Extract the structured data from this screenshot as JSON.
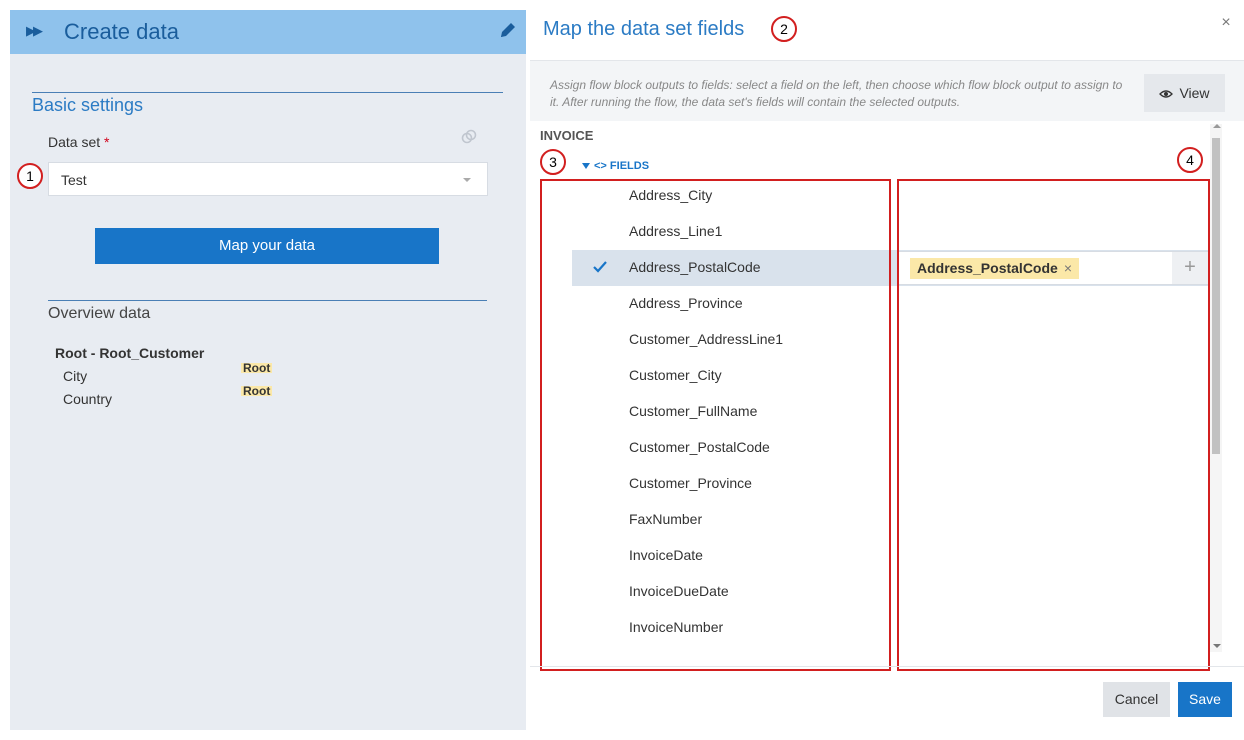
{
  "left_panel": {
    "title": "Create data",
    "basic_settings_title": "Basic settings",
    "dataset_label": "Data set",
    "required_mark": "*",
    "dataset_value": "Test",
    "map_button_label": "Map your data",
    "overview_title": "Overview data",
    "root_title": "Root - Root_Customer",
    "overview_rows": [
      {
        "label": "City",
        "value": "Root"
      },
      {
        "label": "Country",
        "value": "Root"
      }
    ]
  },
  "dialog": {
    "title": "Map the data set fields",
    "close_label": "×",
    "description": "Assign flow block outputs to fields: select a field on the left, then choose which flow block output to assign to it. After running the flow, the data set's fields will contain the selected outputs.",
    "view_button_label": "View",
    "group_label": "INVOICE",
    "fields_label": "FIELDS",
    "fields_tag_symbol": "<>",
    "fields": [
      "Address_City",
      "Address_Line1",
      "Address_PostalCode",
      "Address_Province",
      "Customer_AddressLine1",
      "Customer_City",
      "Customer_FullName",
      "Customer_PostalCode",
      "Customer_Province",
      "FaxNumber",
      "InvoiceDate",
      "InvoiceDueDate",
      "InvoiceNumber"
    ],
    "selected_field": "Address_PostalCode",
    "assigned_output": "Address_PostalCode",
    "remove_symbol": "×",
    "add_symbol": "+",
    "cancel_label": "Cancel",
    "save_label": "Save"
  },
  "callouts": [
    "1",
    "2",
    "3",
    "4"
  ],
  "colors": {
    "accent": "#1875c8",
    "header_bg": "#8fc2ec",
    "panel_bg": "#e8ecf2",
    "highlight": "#fbe8a8",
    "annotation_red": "#d21f1f"
  }
}
